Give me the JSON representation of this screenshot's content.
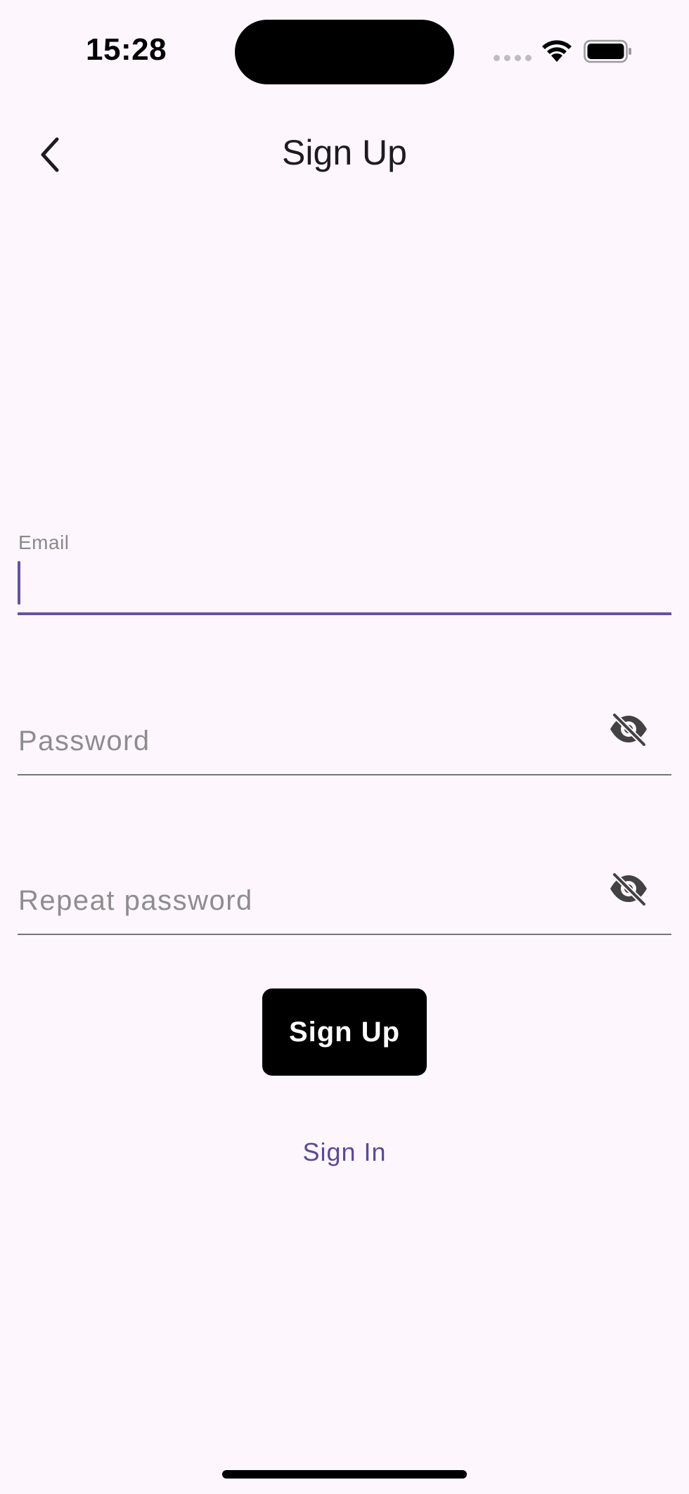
{
  "status_bar": {
    "time": "15:28"
  },
  "header": {
    "title": "Sign Up",
    "back_icon": "chevron-left-icon"
  },
  "form": {
    "email": {
      "label": "Email",
      "value": ""
    },
    "password": {
      "placeholder": "Password",
      "value": "",
      "toggle_icon": "eye-off-icon"
    },
    "repeat_password": {
      "placeholder": "Repeat password",
      "value": "",
      "toggle_icon": "eye-off-icon"
    },
    "submit_label": "Sign Up",
    "signin_link": "Sign In"
  },
  "colors": {
    "background": "#fdf7fd",
    "accent": "#6750a4",
    "link": "#5b4a96",
    "button": "#000000"
  }
}
